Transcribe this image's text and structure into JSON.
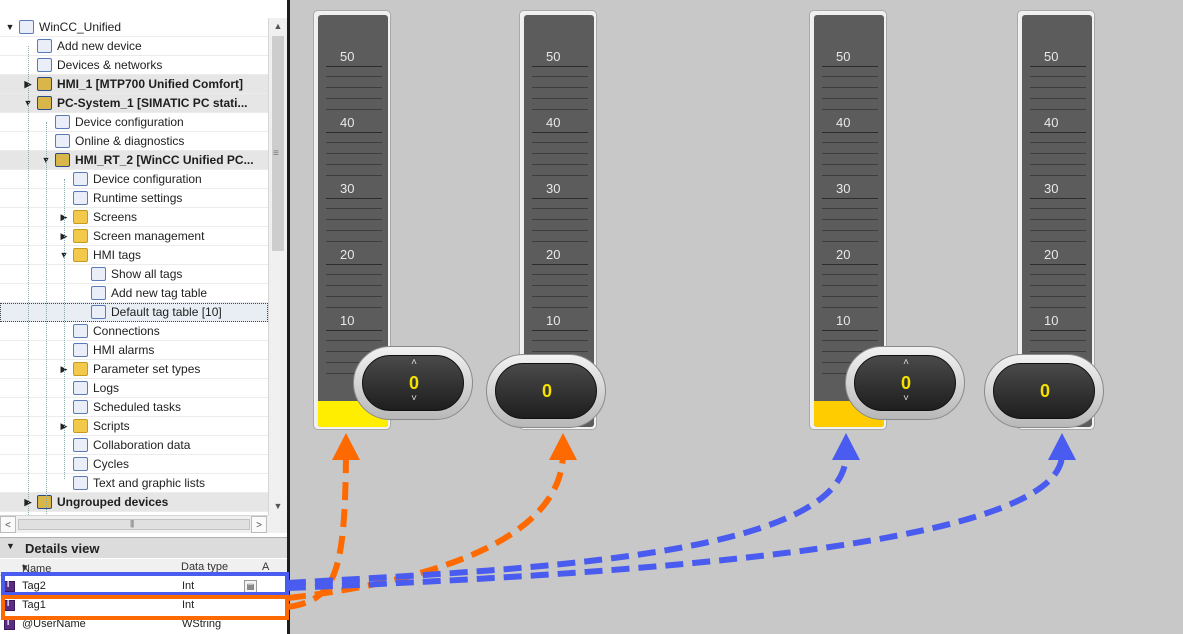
{
  "tree": {
    "items": [
      {
        "label": "WinCC_Unified",
        "icon": "project-file-icon",
        "expander": "▼",
        "bold": false
      },
      {
        "label": "Add new device",
        "icon": "add-device-icon",
        "expander": "",
        "bold": false
      },
      {
        "label": "Devices & networks",
        "icon": "network-icon",
        "expander": "",
        "bold": false
      },
      {
        "label": "HMI_1 [MTP700 Unified Comfort]",
        "icon": "hmi-device-icon",
        "expander": "▶",
        "bold": true
      },
      {
        "label": "PC-System_1 [SIMATIC PC stati...",
        "icon": "pc-station-icon",
        "expander": "▼",
        "bold": true
      },
      {
        "label": "Device configuration",
        "icon": "device-config-icon",
        "expander": "",
        "bold": false
      },
      {
        "label": "Online & diagnostics",
        "icon": "diagnostics-icon",
        "expander": "",
        "bold": false
      },
      {
        "label": "HMI_RT_2 [WinCC Unified PC...",
        "icon": "hmi-runtime-icon",
        "expander": "▼",
        "bold": true
      },
      {
        "label": "Device configuration",
        "icon": "device-config-icon",
        "expander": "",
        "bold": false
      },
      {
        "label": "Runtime settings",
        "icon": "runtime-settings-icon",
        "expander": "",
        "bold": false
      },
      {
        "label": "Screens",
        "icon": "folder-screens-icon",
        "expander": "▶",
        "bold": false
      },
      {
        "label": "Screen management",
        "icon": "folder-screen-management-icon",
        "expander": "▶",
        "bold": false
      },
      {
        "label": "HMI tags",
        "icon": "folder-hmi-tags-icon",
        "expander": "▼",
        "bold": false
      },
      {
        "label": "Show all tags",
        "icon": "show-all-tags-icon",
        "expander": "",
        "bold": false
      },
      {
        "label": "Add new tag table",
        "icon": "add-tag-table-icon",
        "expander": "",
        "bold": false
      },
      {
        "label": "Default tag table [10]",
        "icon": "tag-table-icon",
        "expander": "",
        "bold": false
      },
      {
        "label": "Connections",
        "icon": "connections-icon",
        "expander": "",
        "bold": false
      },
      {
        "label": "HMI alarms",
        "icon": "alarm-envelope-icon",
        "expander": "",
        "bold": false
      },
      {
        "label": "Parameter set types",
        "icon": "folder-parameter-icon",
        "expander": "▶",
        "bold": false
      },
      {
        "label": "Logs",
        "icon": "logs-icon",
        "expander": "",
        "bold": false
      },
      {
        "label": "Scheduled tasks",
        "icon": "scheduled-tasks-icon",
        "expander": "",
        "bold": false
      },
      {
        "label": "Scripts",
        "icon": "folder-scripts-icon",
        "expander": "▶",
        "bold": false
      },
      {
        "label": "Collaboration data",
        "icon": "collaboration-icon",
        "expander": "",
        "bold": false
      },
      {
        "label": "Cycles",
        "icon": "cycles-icon",
        "expander": "",
        "bold": false
      },
      {
        "label": "Text and graphic lists",
        "icon": "text-graphic-lists-icon",
        "expander": "",
        "bold": false
      },
      {
        "label": "Ungrouped devices",
        "icon": "ungrouped-devices-icon",
        "expander": "▶",
        "bold": true
      }
    ]
  },
  "details": {
    "title": "Details view",
    "columns": [
      "Name",
      "Data type",
      "A"
    ],
    "rows": [
      {
        "name": "Tag2",
        "type": "Int"
      },
      {
        "name": "Tag1",
        "type": "Int"
      },
      {
        "name": "@UserName",
        "type": "WString"
      }
    ]
  },
  "gauges": [
    {
      "scale": [
        "50",
        "40",
        "30",
        "20",
        "10"
      ],
      "value": "0",
      "fill_color": "#ffee00",
      "spinner": true
    },
    {
      "scale": [
        "50",
        "40",
        "30",
        "20",
        "10"
      ],
      "value": "0",
      "fill_color": "",
      "spinner": false
    },
    {
      "scale": [
        "50",
        "40",
        "30",
        "20",
        "10"
      ],
      "value": "0",
      "fill_color": "#ffcc00",
      "spinner": true
    },
    {
      "scale": [
        "50",
        "40",
        "30",
        "20",
        "10"
      ],
      "value": "0",
      "fill_color": "",
      "spinner": false
    }
  ],
  "colors": {
    "tag1_link": "#ff6a00",
    "tag2_link": "#4a5cf0",
    "display_value": "#f5e000"
  },
  "icons": {
    "spinner_up": "˄",
    "spinner_down": "˅",
    "tree_scroll_up": "▲",
    "tree_scroll_down": "▼",
    "h_left": "<",
    "h_right": ">",
    "sort": "▾"
  }
}
